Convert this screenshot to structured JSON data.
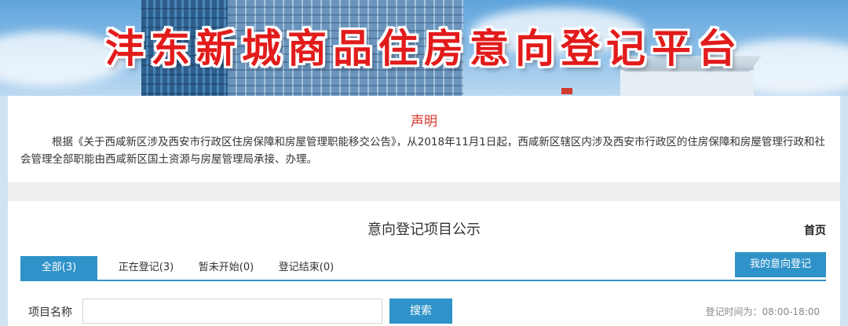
{
  "banner": {
    "title": "沣东新城商品住房意向登记平台"
  },
  "notice": {
    "title": "声明",
    "body": "根据《关于西咸新区涉及西安市行政区住房保障和房屋管理职能移交公告》，从2018年11月1日起，西咸新区辖区内涉及西安市行政区的住房保障和房屋管理行政和社会管理全部职能由西咸新区国土资源与房屋管理局承接、办理。"
  },
  "section": {
    "title": "意向登记项目公示",
    "home_link": "首页"
  },
  "tabs": [
    {
      "label": "全部(3)",
      "active": true
    },
    {
      "label": "正在登记(3)",
      "active": false
    },
    {
      "label": "暂未开始(0)",
      "active": false
    },
    {
      "label": "登记结束(0)",
      "active": false
    }
  ],
  "my_registration_button": "我的意向登记",
  "search": {
    "label": "项目名称",
    "value": "",
    "placeholder": "",
    "button": "搜索"
  },
  "hours_text": "登记时间为：08:00-18:00",
  "colors": {
    "accent": "#2f93c9",
    "title_red": "#e21b1b",
    "notice_red": "#d8322a"
  }
}
